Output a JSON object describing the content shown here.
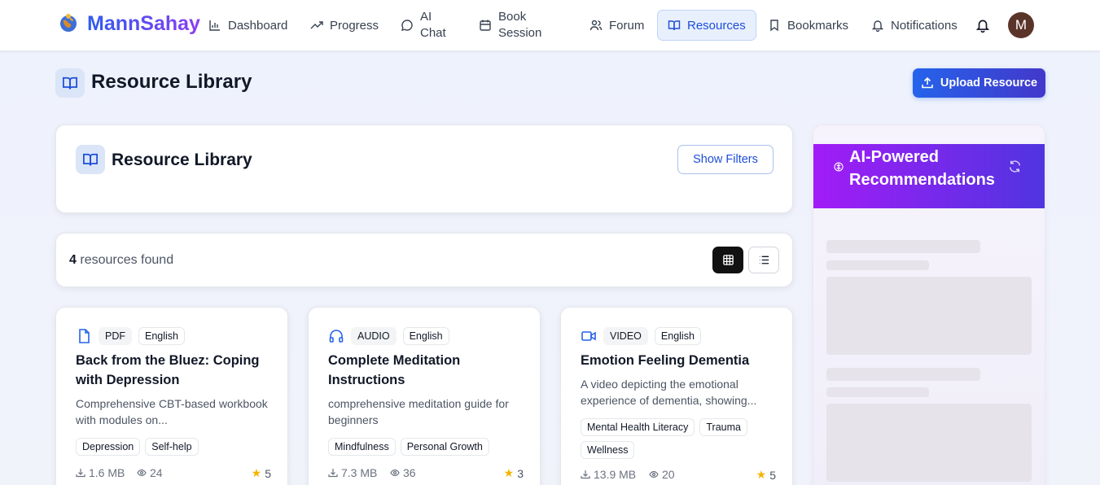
{
  "brand": {
    "name": "MannSahay"
  },
  "nav": {
    "items": [
      {
        "label": "Dashboard",
        "icon": "bar-chart-icon"
      },
      {
        "label": "Progress",
        "icon": "trending-up-icon"
      },
      {
        "label": "AI Chat",
        "icon": "chat-bubble-icon"
      },
      {
        "label": "Book Session",
        "icon": "calendar-icon"
      },
      {
        "label": "Forum",
        "icon": "users-icon"
      },
      {
        "label": "Resources",
        "icon": "book-open-icon",
        "active": true
      },
      {
        "label": "Bookmarks",
        "icon": "bookmark-icon"
      },
      {
        "label": "Notifications",
        "icon": "bell-icon"
      }
    ],
    "avatar_initial": "M"
  },
  "page": {
    "title": "Resource Library",
    "upload_label": "Upload Resource"
  },
  "library": {
    "title": "Resource Library",
    "filter_label": "Show Filters"
  },
  "results": {
    "count": "4",
    "count_suffix": "resources found",
    "active_view": "grid"
  },
  "resources": [
    {
      "type": "PDF",
      "language": "English",
      "icon": "file-icon",
      "title": "Back from the Bluez: Coping with Depression",
      "description": "Comprehensive CBT-based workbook with modules on...",
      "categories": [
        "Depression",
        "Self-help"
      ],
      "size": "1.6 MB",
      "views": "24",
      "rating": "5"
    },
    {
      "type": "AUDIO",
      "language": "English",
      "icon": "headphones-icon",
      "title": "Complete Meditation Instructions",
      "description": "comprehensive meditation guide for beginners",
      "categories": [
        "Mindfulness",
        "Personal Growth"
      ],
      "size": "7.3 MB",
      "views": "36",
      "rating": "3"
    },
    {
      "type": "VIDEO",
      "language": "English",
      "icon": "video-camera-icon",
      "title": "Emotion Feeling Dementia",
      "description": "A video depicting the emotional experience of dementia, showing...",
      "categories": [
        "Mental Health Literacy",
        "Trauma",
        "Wellness"
      ],
      "size": "13.9 MB",
      "views": "20",
      "rating": "5"
    }
  ],
  "ai_panel": {
    "title": "AI-Powered Recommendations",
    "state": "loading"
  },
  "colors": {
    "primary": "#2563eb",
    "brand_gradient_start": "#2f5cf0",
    "brand_gradient_end": "#8b3df2",
    "ai_gradient_start": "#a21cf7",
    "ai_gradient_end": "#4f35e0",
    "star": "#f5b301"
  }
}
